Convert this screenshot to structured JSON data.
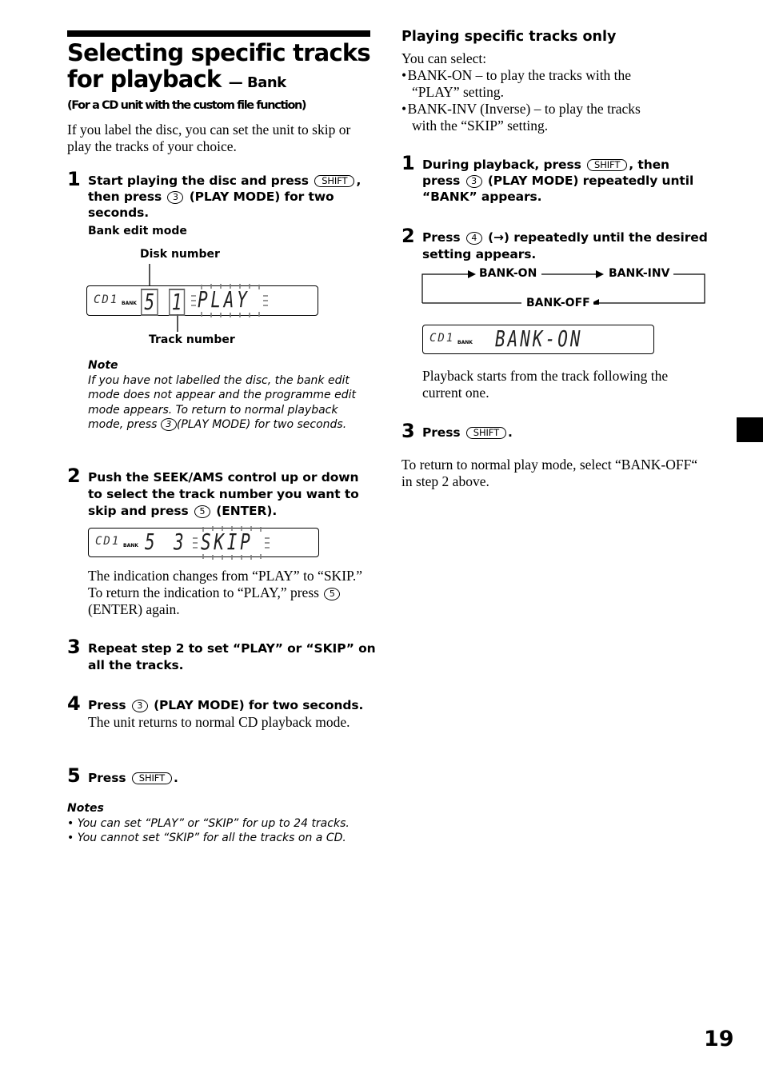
{
  "page": {
    "title_main": "Selecting specific tracks for playback",
    "title_line1": "Selecting specific tracks",
    "title_line2": "for playback",
    "title_suffix": "— Bank",
    "subtitle": "(For a CD unit with the custom file function)",
    "intro": "If you label the disc, you can set the unit to skip or play the tracks of your choice.",
    "page_number": "19"
  },
  "keys": {
    "shift": "SHIFT",
    "num3": "3",
    "num4": "4",
    "num5": "5"
  },
  "left_steps": [
    {
      "number": "1",
      "parts": [
        "Start playing the disc and press",
        ", then press",
        "(PLAY MODE) for two seconds."
      ],
      "caption": "Bank edit mode",
      "display": {
        "label_top": "Disk number",
        "label_bottom": "Track number",
        "cd": "CD1",
        "bank": "BANK",
        "disk": "5",
        "track": "1",
        "mode": "PLAY"
      },
      "note_title": "Note",
      "note_text_1": "If you have not labelled the disc, the bank edit mode does not appear and the programme edit mode appears. To return to normal playback mode, press",
      "note_text_2": "(PLAY MODE) for two seconds."
    },
    {
      "number": "2",
      "parts": [
        "Push the SEEK/AMS control up or down to select the track number you want to skip and press",
        "(ENTER)."
      ],
      "display": {
        "cd": "CD1",
        "bank": "BANK",
        "disk": "5",
        "track": "3",
        "mode": "SKIP"
      },
      "desc_1": "The indication changes from “PLAY” to “SKIP.” To return the indication to “PLAY,” press",
      "desc_2": "(ENTER) again."
    },
    {
      "number": "3",
      "text": "Repeat step 2 to set “PLAY” or “SKIP” on all the tracks."
    },
    {
      "number": "4",
      "parts": [
        "Press",
        "(PLAY MODE) for two seconds."
      ],
      "desc": "The unit returns to normal CD playback mode."
    },
    {
      "number": "5",
      "parts": [
        "Press",
        "."
      ]
    }
  ],
  "left_notes": {
    "title": "Notes",
    "items": [
      "You can set “PLAY” or “SKIP” for up to 24 tracks.",
      "You cannot set “SKIP” for all the tracks on a CD."
    ]
  },
  "right": {
    "heading": "Playing specific tracks only",
    "intro": "You can select:",
    "options": [
      {
        "line1": "BANK-ON – to play the tracks with the",
        "line2": "“PLAY” setting."
      },
      {
        "line1": "BANK-INV (Inverse) – to play the tracks",
        "line2": "with the “SKIP” setting."
      }
    ],
    "steps": [
      {
        "number": "1",
        "parts": [
          "During playback, press",
          ", then press",
          "(PLAY MODE) repeatedly until “BANK” appears."
        ]
      },
      {
        "number": "2",
        "parts": [
          "Press",
          "(→) repeatedly until the desired setting appears."
        ]
      },
      {
        "number": "3",
        "parts": [
          "Press",
          "."
        ]
      }
    ],
    "cycle": [
      "BANK-ON",
      "BANK-INV",
      "BANK-OFF"
    ],
    "display": {
      "cd": "CD1",
      "bank": "BANK",
      "text": "BANK-ON"
    },
    "after_display": "Playback starts from the track following the current one.",
    "footer": "To return to normal play mode, select “BANK-OFF“ in step 2 above."
  }
}
